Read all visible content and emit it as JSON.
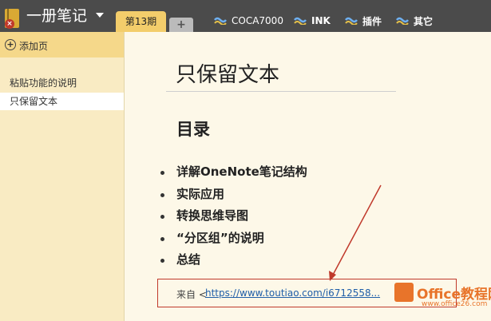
{
  "topbar": {
    "notebook_title": "一册笔记",
    "active_tab": "第13期",
    "add_tab": "+",
    "section_tabs": [
      {
        "label": "COCA7000",
        "color": "#4f8fd6"
      },
      {
        "label": "INK",
        "color": "#4f8fd6"
      },
      {
        "label": "插件",
        "color": "#4f8fd6"
      },
      {
        "label": "其它",
        "color": "#4f8fd6"
      }
    ]
  },
  "sidebar": {
    "add_page": "添加页",
    "pages": [
      {
        "label": "粘贴功能的说明"
      },
      {
        "label": "只保留文本"
      }
    ]
  },
  "page": {
    "title": "只保留文本",
    "heading": "目录",
    "toc": [
      "详解OneNote笔记结构",
      "实际应用",
      "转换思维导图",
      "“分区组”的说明",
      "总结"
    ],
    "source_prefix": "来自 <",
    "source_link": "https://www.toutiao.com/i6712558..."
  },
  "watermark": {
    "line1": "Office教程网",
    "line2": "www.office26.com"
  },
  "colors": {
    "accent_tab": "#f3cd6b",
    "annotation_red": "#c0392b"
  }
}
